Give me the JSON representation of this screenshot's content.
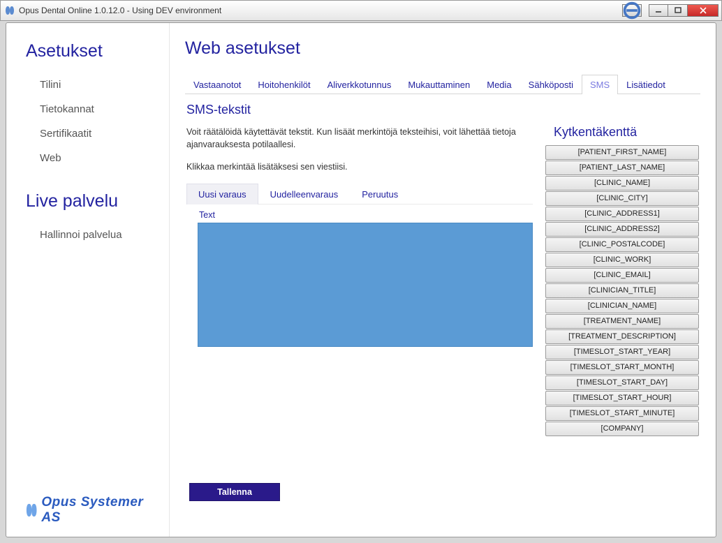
{
  "window": {
    "title": "Opus Dental Online 1.0.12.0 - Using DEV environment"
  },
  "sidebar": {
    "group1_title": "Asetukset",
    "items1": [
      "Tilini",
      "Tietokannat",
      "Sertifikaatit",
      "Web"
    ],
    "group2_title": "Live palvelu",
    "items2": [
      "Hallinnoi palvelua"
    ],
    "company": "Opus Systemer AS"
  },
  "main": {
    "title": "Web asetukset",
    "tabs": [
      "Vastaanotot",
      "Hoitohenkilöt",
      "Aliverkkotunnus",
      "Mukauttaminen",
      "Media",
      "Sähköposti",
      "SMS",
      "Lisätiedot"
    ],
    "active_tab": "SMS",
    "sms": {
      "heading": "SMS-tekstit",
      "desc1": "Voit räätälöidä käytettävät tekstit. Kun lisäät merkintöjä teksteihisi, voit lähettää tietoja ajanvarauksesta potilaallesi.",
      "desc2": "Klikkaa merkintää lisätäksesi sen viestiisi.",
      "subtabs": [
        "Uusi varaus",
        "Uudelleenvaraus",
        "Peruutus"
      ],
      "active_subtab": "Uusi varaus",
      "textarea_label": "Text",
      "textarea_value": "",
      "save_label": "Tallenna"
    },
    "merge": {
      "title": "Kytkentäkenttä",
      "fields": [
        "[PATIENT_FIRST_NAME]",
        "[PATIENT_LAST_NAME]",
        "[CLINIC_NAME]",
        "[CLINIC_CITY]",
        "[CLINIC_ADDRESS1]",
        "[CLINIC_ADDRESS2]",
        "[CLINIC_POSTALCODE]",
        "[CLINIC_WORK]",
        "[CLINIC_EMAIL]",
        "[CLINICIAN_TITLE]",
        "[CLINICIAN_NAME]",
        "[TREATMENT_NAME]",
        "[TREATMENT_DESCRIPTION]",
        "[TIMESLOT_START_YEAR]",
        "[TIMESLOT_START_MONTH]",
        "[TIMESLOT_START_DAY]",
        "[TIMESLOT_START_HOUR]",
        "[TIMESLOT_START_MINUTE]",
        "[COMPANY]"
      ]
    }
  }
}
